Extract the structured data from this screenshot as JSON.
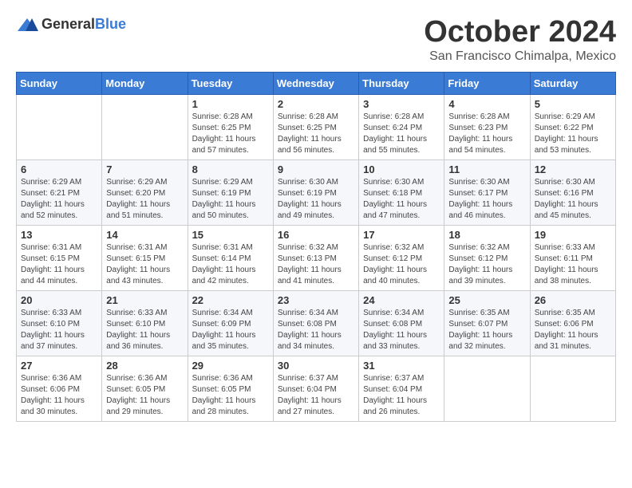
{
  "header": {
    "logo_general": "General",
    "logo_blue": "Blue",
    "month": "October 2024",
    "location": "San Francisco Chimalpa, Mexico"
  },
  "weekdays": [
    "Sunday",
    "Monday",
    "Tuesday",
    "Wednesday",
    "Thursday",
    "Friday",
    "Saturday"
  ],
  "weeks": [
    [
      {
        "day": "",
        "info": ""
      },
      {
        "day": "",
        "info": ""
      },
      {
        "day": "1",
        "info": "Sunrise: 6:28 AM\nSunset: 6:25 PM\nDaylight: 11 hours and 57 minutes."
      },
      {
        "day": "2",
        "info": "Sunrise: 6:28 AM\nSunset: 6:25 PM\nDaylight: 11 hours and 56 minutes."
      },
      {
        "day": "3",
        "info": "Sunrise: 6:28 AM\nSunset: 6:24 PM\nDaylight: 11 hours and 55 minutes."
      },
      {
        "day": "4",
        "info": "Sunrise: 6:28 AM\nSunset: 6:23 PM\nDaylight: 11 hours and 54 minutes."
      },
      {
        "day": "5",
        "info": "Sunrise: 6:29 AM\nSunset: 6:22 PM\nDaylight: 11 hours and 53 minutes."
      }
    ],
    [
      {
        "day": "6",
        "info": "Sunrise: 6:29 AM\nSunset: 6:21 PM\nDaylight: 11 hours and 52 minutes."
      },
      {
        "day": "7",
        "info": "Sunrise: 6:29 AM\nSunset: 6:20 PM\nDaylight: 11 hours and 51 minutes."
      },
      {
        "day": "8",
        "info": "Sunrise: 6:29 AM\nSunset: 6:19 PM\nDaylight: 11 hours and 50 minutes."
      },
      {
        "day": "9",
        "info": "Sunrise: 6:30 AM\nSunset: 6:19 PM\nDaylight: 11 hours and 49 minutes."
      },
      {
        "day": "10",
        "info": "Sunrise: 6:30 AM\nSunset: 6:18 PM\nDaylight: 11 hours and 47 minutes."
      },
      {
        "day": "11",
        "info": "Sunrise: 6:30 AM\nSunset: 6:17 PM\nDaylight: 11 hours and 46 minutes."
      },
      {
        "day": "12",
        "info": "Sunrise: 6:30 AM\nSunset: 6:16 PM\nDaylight: 11 hours and 45 minutes."
      }
    ],
    [
      {
        "day": "13",
        "info": "Sunrise: 6:31 AM\nSunset: 6:15 PM\nDaylight: 11 hours and 44 minutes."
      },
      {
        "day": "14",
        "info": "Sunrise: 6:31 AM\nSunset: 6:15 PM\nDaylight: 11 hours and 43 minutes."
      },
      {
        "day": "15",
        "info": "Sunrise: 6:31 AM\nSunset: 6:14 PM\nDaylight: 11 hours and 42 minutes."
      },
      {
        "day": "16",
        "info": "Sunrise: 6:32 AM\nSunset: 6:13 PM\nDaylight: 11 hours and 41 minutes."
      },
      {
        "day": "17",
        "info": "Sunrise: 6:32 AM\nSunset: 6:12 PM\nDaylight: 11 hours and 40 minutes."
      },
      {
        "day": "18",
        "info": "Sunrise: 6:32 AM\nSunset: 6:12 PM\nDaylight: 11 hours and 39 minutes."
      },
      {
        "day": "19",
        "info": "Sunrise: 6:33 AM\nSunset: 6:11 PM\nDaylight: 11 hours and 38 minutes."
      }
    ],
    [
      {
        "day": "20",
        "info": "Sunrise: 6:33 AM\nSunset: 6:10 PM\nDaylight: 11 hours and 37 minutes."
      },
      {
        "day": "21",
        "info": "Sunrise: 6:33 AM\nSunset: 6:10 PM\nDaylight: 11 hours and 36 minutes."
      },
      {
        "day": "22",
        "info": "Sunrise: 6:34 AM\nSunset: 6:09 PM\nDaylight: 11 hours and 35 minutes."
      },
      {
        "day": "23",
        "info": "Sunrise: 6:34 AM\nSunset: 6:08 PM\nDaylight: 11 hours and 34 minutes."
      },
      {
        "day": "24",
        "info": "Sunrise: 6:34 AM\nSunset: 6:08 PM\nDaylight: 11 hours and 33 minutes."
      },
      {
        "day": "25",
        "info": "Sunrise: 6:35 AM\nSunset: 6:07 PM\nDaylight: 11 hours and 32 minutes."
      },
      {
        "day": "26",
        "info": "Sunrise: 6:35 AM\nSunset: 6:06 PM\nDaylight: 11 hours and 31 minutes."
      }
    ],
    [
      {
        "day": "27",
        "info": "Sunrise: 6:36 AM\nSunset: 6:06 PM\nDaylight: 11 hours and 30 minutes."
      },
      {
        "day": "28",
        "info": "Sunrise: 6:36 AM\nSunset: 6:05 PM\nDaylight: 11 hours and 29 minutes."
      },
      {
        "day": "29",
        "info": "Sunrise: 6:36 AM\nSunset: 6:05 PM\nDaylight: 11 hours and 28 minutes."
      },
      {
        "day": "30",
        "info": "Sunrise: 6:37 AM\nSunset: 6:04 PM\nDaylight: 11 hours and 27 minutes."
      },
      {
        "day": "31",
        "info": "Sunrise: 6:37 AM\nSunset: 6:04 PM\nDaylight: 11 hours and 26 minutes."
      },
      {
        "day": "",
        "info": ""
      },
      {
        "day": "",
        "info": ""
      }
    ]
  ]
}
